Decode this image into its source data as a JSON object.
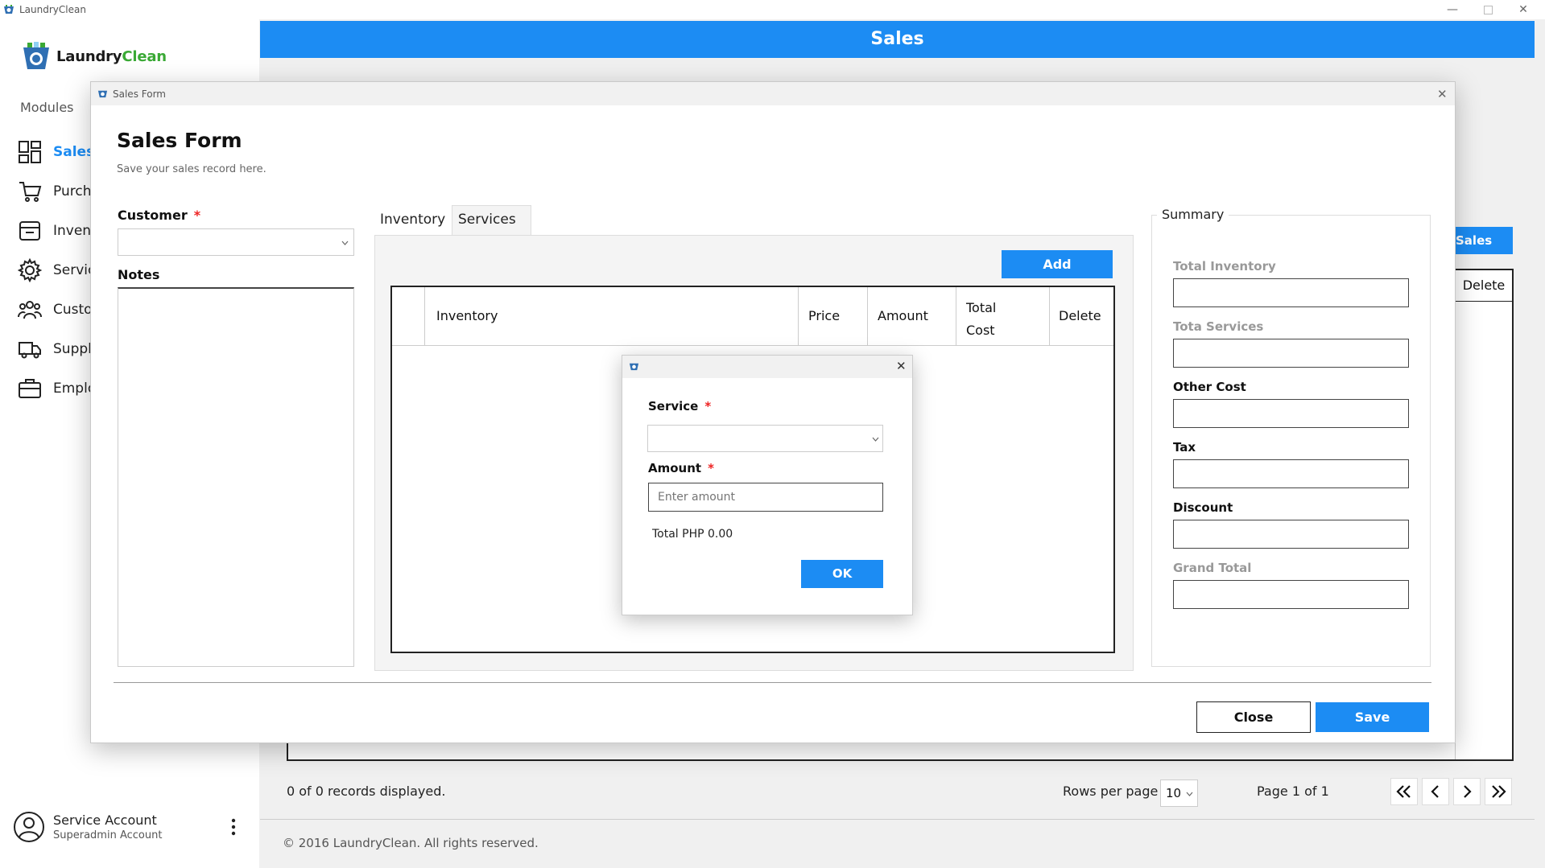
{
  "app": {
    "title": "LaundryClean",
    "logo_text": "LaundryClean"
  },
  "window": {
    "minimize_icon": "minimize-icon",
    "maximize_icon": "maximize-icon",
    "close_icon": "close-icon"
  },
  "sidebar": {
    "modules_label": "Modules",
    "items": [
      {
        "label": "Sales",
        "icon": "dashboard-icon",
        "active": true
      },
      {
        "label": "Purchases",
        "icon": "cart-icon"
      },
      {
        "label": "Inventory",
        "icon": "inventory-icon"
      },
      {
        "label": "Services",
        "icon": "gear-icon"
      },
      {
        "label": "Customers",
        "icon": "users-icon"
      },
      {
        "label": "Suppliers",
        "icon": "truck-icon"
      },
      {
        "label": "Employees",
        "icon": "briefcase-icon"
      }
    ],
    "account": {
      "name": "Service Account",
      "role": "Superadmin Account"
    }
  },
  "main": {
    "banner_title": "Sales",
    "bg_button_label": "Sales",
    "bg_table_delete_header": "Delete",
    "records_text": "0 of 0 records displayed.",
    "rows_per_page_label": "Rows per page",
    "rows_per_page_value": "10",
    "page_text": "Page 1 of 1",
    "copyright": "© 2016 LaundryClean. All rights reserved."
  },
  "sales_form": {
    "window_title": "Sales Form",
    "heading": "Sales Form",
    "subtitle": "Save your sales record here.",
    "customer_label": "Customer",
    "customer_value": "",
    "notes_label": "Notes",
    "notes_value": "",
    "tabs": [
      {
        "label": "Inventory"
      },
      {
        "label": "Services",
        "active": true
      }
    ],
    "add_label": "Add",
    "table_headers": [
      "Inventory",
      "Price",
      "Amount",
      "Total Cost",
      "Delete"
    ],
    "summary": {
      "title": "Summary",
      "fields": [
        {
          "label": "Total Inventory",
          "value": ""
        },
        {
          "label": "Tota Services",
          "value": ""
        },
        {
          "label": "Other Cost",
          "value": ""
        },
        {
          "label": "Tax",
          "value": ""
        },
        {
          "label": "Discount",
          "value": ""
        },
        {
          "label": "Grand Total",
          "value": ""
        }
      ]
    },
    "close_label": "Close",
    "save_label": "Save"
  },
  "service_dialog": {
    "service_label": "Service",
    "service_value": "",
    "amount_label": "Amount",
    "amount_placeholder": "Enter amount",
    "total_text": "Total PHP 0.00",
    "ok_label": "OK"
  },
  "colors": {
    "accent": "#1c8cf3",
    "required": "#e22222",
    "logo_green": "#3aa935"
  }
}
